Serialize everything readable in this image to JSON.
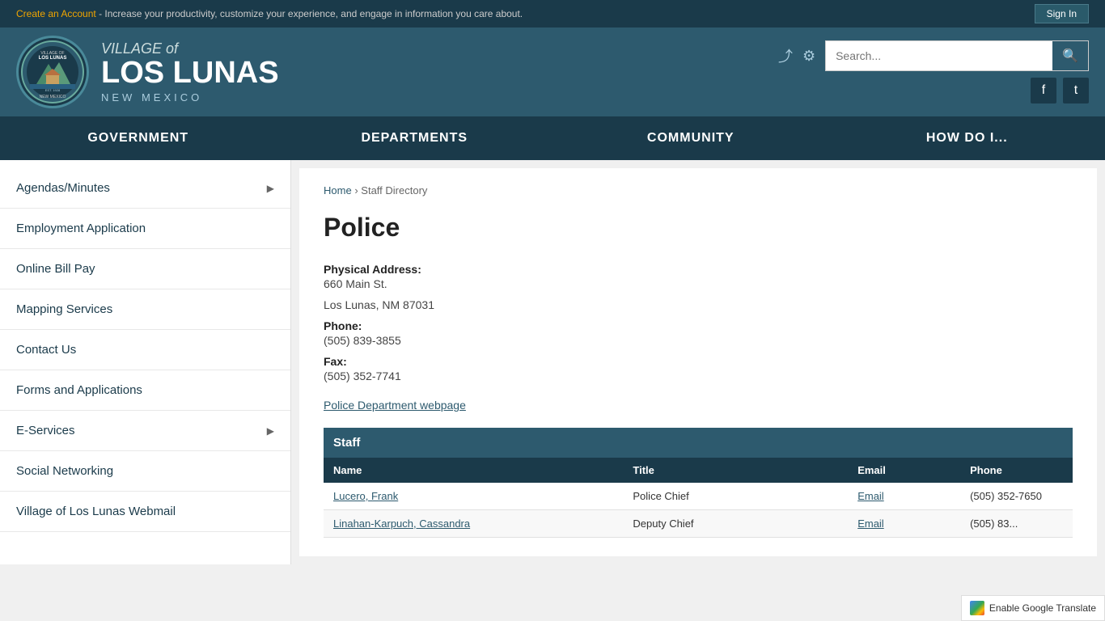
{
  "topbar": {
    "create_account_text": "Create an Account",
    "message": " - Increase your productivity, customize your experience, and engage in information you care about.",
    "sign_in_label": "Sign In"
  },
  "header": {
    "village_of": "VILLAGE of",
    "city_name": "LOS LUNAS",
    "state": "NEW MEXICO",
    "search_placeholder": "Search...",
    "icons": {
      "share": "⤴",
      "settings": "⚙",
      "facebook": "f",
      "twitter": "t"
    }
  },
  "nav": {
    "items": [
      {
        "label": "GOVERNMENT"
      },
      {
        "label": "DEPARTMENTS"
      },
      {
        "label": "COMMUNITY"
      },
      {
        "label": "HOW DO I..."
      }
    ]
  },
  "sidebar": {
    "items": [
      {
        "label": "Agendas/Minutes",
        "has_arrow": true
      },
      {
        "label": "Employment Application",
        "has_arrow": false
      },
      {
        "label": "Online Bill Pay",
        "has_arrow": false
      },
      {
        "label": "Mapping Services",
        "has_arrow": false
      },
      {
        "label": "Contact Us",
        "has_arrow": false
      },
      {
        "label": "Forms and Applications",
        "has_arrow": false
      },
      {
        "label": "E-Services",
        "has_arrow": true
      },
      {
        "label": "Social Networking",
        "has_arrow": false
      },
      {
        "label": "Village of Los Lunas Webmail",
        "has_arrow": false
      }
    ]
  },
  "breadcrumb": {
    "home": "Home",
    "separator": "›",
    "current": "Staff Directory"
  },
  "department": {
    "title": "Police",
    "address_label": "Physical Address:",
    "address_line1": "660 Main St.",
    "address_line2": "Los Lunas, NM 87031",
    "phone_label": "Phone:",
    "phone": "(505) 839-3855",
    "fax_label": "Fax:",
    "fax": "(505) 352-7741",
    "webpage_link": "Police Department webpage"
  },
  "staff_table": {
    "header": "Staff",
    "columns": [
      "Name",
      "Title",
      "Email",
      "Phone"
    ],
    "rows": [
      {
        "name": "Lucero, Frank",
        "title": "Police Chief",
        "email": "Email",
        "phone": "(505) 352-7650"
      },
      {
        "name": "Linahan-Karpuch, Cassandra",
        "title": "Deputy Chief",
        "email": "Email",
        "phone": "(505) 83..."
      }
    ]
  },
  "translate": {
    "label": "Enable Google Translate"
  }
}
